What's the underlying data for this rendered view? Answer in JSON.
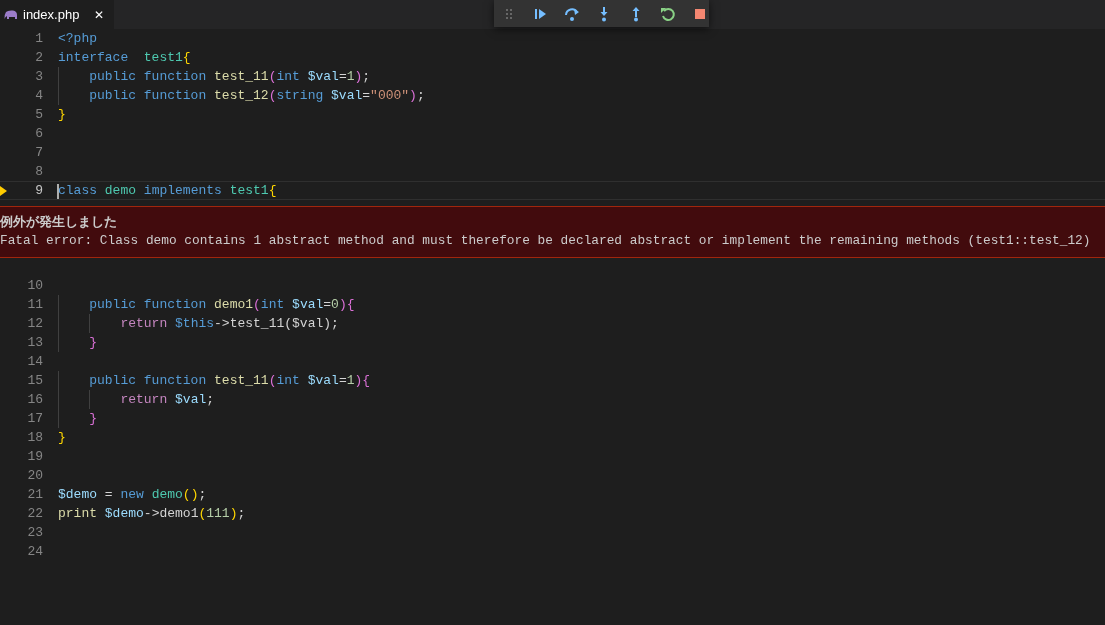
{
  "tab": {
    "label": "index.php",
    "close": "✕",
    "selected": true
  },
  "debug_toolbar": [
    {
      "kind": "grip"
    },
    {
      "kind": "continue"
    },
    {
      "kind": "step_over"
    },
    {
      "kind": "step_into"
    },
    {
      "kind": "step_out"
    },
    {
      "kind": "restart"
    },
    {
      "kind": "stop"
    }
  ],
  "lines": [
    {
      "number": "1",
      "current": false,
      "tokens": [
        {
          "text": "<?php",
          "kind": "kw"
        }
      ]
    },
    {
      "number": "2",
      "current": false,
      "tokens": [
        {
          "text": "interface",
          "kind": "kw"
        },
        {
          "text": "  test1",
          "kind": "cls"
        },
        {
          "text": "{",
          "kind": "b1"
        }
      ]
    },
    {
      "number": "3",
      "current": false,
      "tokens": [
        {
          "text": "    public function ",
          "kind": "kw"
        },
        {
          "text": "test_11",
          "kind": "fn"
        },
        {
          "text": "(",
          "kind": "b2"
        },
        {
          "text": "int ",
          "kind": "kw"
        },
        {
          "text": "$val",
          "kind": "var"
        },
        {
          "text": "=",
          "kind": "plain"
        },
        {
          "text": "1",
          "kind": "num"
        },
        {
          "text": ")",
          "kind": "b2"
        },
        {
          "text": ";",
          "kind": "plain"
        }
      ]
    },
    {
      "number": "4",
      "current": false,
      "tokens": [
        {
          "text": "    public function ",
          "kind": "kw"
        },
        {
          "text": "test_12",
          "kind": "fn"
        },
        {
          "text": "(",
          "kind": "b2"
        },
        {
          "text": "string ",
          "kind": "kw"
        },
        {
          "text": "$val",
          "kind": "var"
        },
        {
          "text": "=",
          "kind": "plain"
        },
        {
          "text": "\"000\"",
          "kind": "str"
        },
        {
          "text": ")",
          "kind": "b2"
        },
        {
          "text": ";",
          "kind": "plain"
        }
      ]
    },
    {
      "number": "5",
      "current": false,
      "tokens": [
        {
          "text": "}",
          "kind": "b1"
        }
      ]
    },
    {
      "number": "6",
      "current": false
    },
    {
      "number": "7",
      "current": false
    },
    {
      "number": "8",
      "current": false
    },
    {
      "number": "9",
      "current": true,
      "tokens": [
        {
          "text": "class ",
          "kind": "kw"
        },
        {
          "text": "demo ",
          "kind": "cls"
        },
        {
          "text": "implements ",
          "kind": "kw"
        },
        {
          "text": "test1",
          "kind": "cls"
        },
        {
          "text": "{",
          "kind": "b1"
        }
      ]
    },
    {
      "number": "10",
      "current": false
    },
    {
      "number": "11",
      "current": false,
      "tokens": [
        {
          "text": "    public function ",
          "kind": "kw"
        },
        {
          "text": "demo1",
          "kind": "fn"
        },
        {
          "text": "(",
          "kind": "b2"
        },
        {
          "text": "int ",
          "kind": "kw"
        },
        {
          "text": "$val",
          "kind": "var"
        },
        {
          "text": "=",
          "kind": "plain"
        },
        {
          "text": "0",
          "kind": "num"
        },
        {
          "text": ")",
          "kind": "b2"
        },
        {
          "text": "{",
          "kind": "b2"
        }
      ]
    },
    {
      "number": "12",
      "current": false,
      "tokens": [
        {
          "text": "        return ",
          "kind": "ctrl"
        },
        {
          "text": "$this",
          "kind": "kw"
        },
        {
          "text": "->test_11($val);",
          "kind": "plain"
        }
      ]
    },
    {
      "number": "13",
      "current": false,
      "tokens": [
        {
          "text": "    }",
          "kind": "b2"
        }
      ]
    },
    {
      "number": "14",
      "current": false
    },
    {
      "number": "15",
      "current": false,
      "tokens": [
        {
          "text": "    public function ",
          "kind": "kw"
        },
        {
          "text": "test_11",
          "kind": "fn"
        },
        {
          "text": "(",
          "kind": "b2"
        },
        {
          "text": "int ",
          "kind": "kw"
        },
        {
          "text": "$val",
          "kind": "var"
        },
        {
          "text": "=",
          "kind": "plain"
        },
        {
          "text": "1",
          "kind": "num"
        },
        {
          "text": ")",
          "kind": "b2"
        },
        {
          "text": "{",
          "kind": "b2"
        }
      ]
    },
    {
      "number": "16",
      "current": false,
      "tokens": [
        {
          "text": "        return ",
          "kind": "ctrl"
        },
        {
          "text": "$val",
          "kind": "var"
        },
        {
          "text": ";",
          "kind": "plain"
        }
      ]
    },
    {
      "number": "17",
      "current": false,
      "tokens": [
        {
          "text": "    }",
          "kind": "b2"
        }
      ]
    },
    {
      "number": "18",
      "current": false,
      "tokens": [
        {
          "text": "}",
          "kind": "b1"
        }
      ]
    },
    {
      "number": "19",
      "current": false
    },
    {
      "number": "20",
      "current": false
    },
    {
      "number": "21",
      "current": false,
      "tokens": [
        {
          "text": "$demo",
          "kind": "var"
        },
        {
          "text": " = ",
          "kind": "plain"
        },
        {
          "text": "new ",
          "kind": "kw"
        },
        {
          "text": "demo",
          "kind": "cls"
        },
        {
          "text": "()",
          "kind": "b1"
        },
        {
          "text": ";",
          "kind": "plain"
        }
      ]
    },
    {
      "number": "22",
      "current": false,
      "tokens": [
        {
          "text": "print ",
          "kind": "fn"
        },
        {
          "text": "$demo",
          "kind": "var"
        },
        {
          "text": "->demo1",
          "kind": "plain"
        },
        {
          "text": "(",
          "kind": "b1"
        },
        {
          "text": "111",
          "kind": "num"
        },
        {
          "text": ")",
          "kind": "b1"
        },
        {
          "text": ";",
          "kind": "plain"
        }
      ]
    },
    {
      "number": "23",
      "current": false
    },
    {
      "number": "24",
      "current": false
    }
  ],
  "exception": {
    "title": "例外が発生しました",
    "message": "Fatal error: Class demo contains 1 abstract method and must therefore be declared abstract or implement the remaining methods (test1::test_12)"
  }
}
